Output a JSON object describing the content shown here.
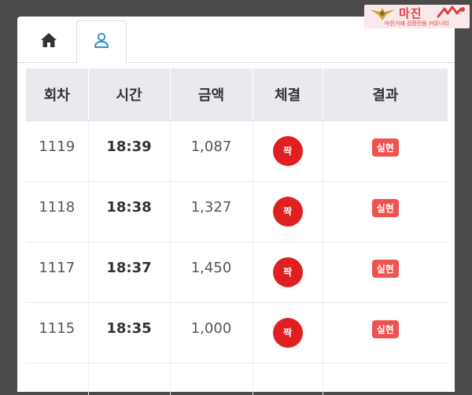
{
  "tabs": [
    {
      "icon": "home-icon"
    },
    {
      "icon": "user-icon",
      "active": true
    }
  ],
  "table": {
    "headers": [
      "회차",
      "시간",
      "금액",
      "체결",
      "결과"
    ],
    "rows": [
      {
        "round": "1119",
        "time": "18:39",
        "amount": "1,087",
        "fill": "짝",
        "result": "실현"
      },
      {
        "round": "1118",
        "time": "18:38",
        "amount": "1,327",
        "fill": "짝",
        "result": "실현"
      },
      {
        "round": "1117",
        "time": "18:37",
        "amount": "1,450",
        "fill": "짝",
        "result": "실현"
      },
      {
        "round": "1115",
        "time": "18:35",
        "amount": "1,000",
        "fill": "짝",
        "result": "실현"
      }
    ]
  },
  "logo": {
    "title": "마진",
    "subtitle": "마진거래 검증전용 커뮤니티"
  },
  "colors": {
    "fill_circle": "#e02020",
    "result_badge": "#ef5350",
    "active_tab_icon": "#2f8fd6",
    "header_bg": "#e8eaed"
  }
}
